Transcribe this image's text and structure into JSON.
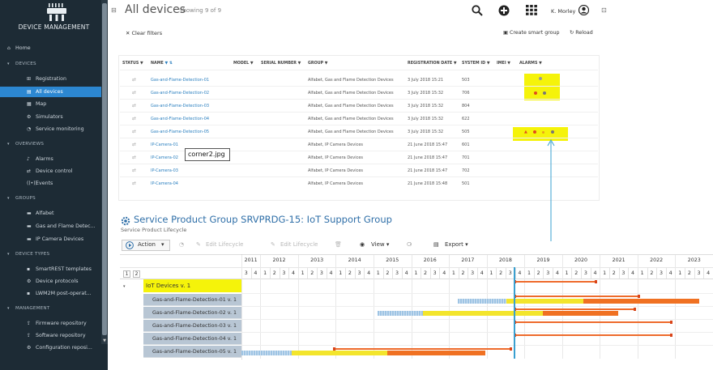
{
  "sidebar": {
    "brand": "DEVICE MANAGEMENT",
    "home": "Home",
    "sections": {
      "devices": "DEVICES",
      "overviews": "OVERVIEWS",
      "groups": "GROUPS",
      "device_types": "DEVICE TYPES",
      "management": "MANAGEMENT"
    },
    "devices_items": [
      "Registration",
      "All devices",
      "Map",
      "Simulators",
      "Service monitoring"
    ],
    "overviews_items": [
      "Alarms",
      "Device control",
      "Events"
    ],
    "groups_items": [
      "Alfabet",
      "Gas and Flame Detec...",
      "IP Camera Devices"
    ],
    "device_types_items": [
      "SmartREST templates",
      "Device protocols",
      "LWM2M post-operat..."
    ],
    "management_items": [
      "Firmware repository",
      "Software repository",
      "Configuration reposi..."
    ]
  },
  "header": {
    "title": "All devices",
    "showing": "Showing 9 of 9",
    "user": "K. Morley",
    "clear_filters": "Clear filters",
    "create_smart_group": "Create smart group",
    "reload": "Reload"
  },
  "table": {
    "columns": [
      "STATUS",
      "NAME",
      "MODEL",
      "SERIAL NUMBER",
      "GROUP",
      "REGISTRATION DATE",
      "SYSTEM ID",
      "IMEI",
      "ALARMS"
    ],
    "rows": [
      {
        "name": "Gas-and-Flame-Detection-01",
        "group": "Alfabet, Gas and Flame Detection Devices",
        "date": "3 July 2018 15:21",
        "id": "503"
      },
      {
        "name": "Gas-and-Flame-Detection-02",
        "group": "Alfabet, Gas and Flame Detection Devices",
        "date": "3 July 2018 15:32",
        "id": "706"
      },
      {
        "name": "Gas-and-Flame-Detection-03",
        "group": "Alfabet, Gas and Flame Detection Devices",
        "date": "3 July 2018 15:32",
        "id": "804"
      },
      {
        "name": "Gas-and-Flame-Detection-04",
        "group": "Alfabet, Gas and Flame Detection Devices",
        "date": "3 July 2018 15:32",
        "id": "622"
      },
      {
        "name": "Gas-and-Flame-Detection-05",
        "group": "Alfabet, Gas and Flame Detection Devices",
        "date": "3 July 2018 15:32",
        "id": "505"
      },
      {
        "name": "IP-Camera-01",
        "group": "Alfabet, IP Camera Devices",
        "date": "21 June 2018 15:47",
        "id": "601"
      },
      {
        "name": "IP-Camera-02",
        "group": "Alfabet, IP Camera Devices",
        "date": "21 June 2018 15:47",
        "id": "701"
      },
      {
        "name": "IP-Camera-03",
        "group": "Alfabet, IP Camera Devices",
        "date": "21 June 2018 15:47",
        "id": "702"
      },
      {
        "name": "IP-Camera-04",
        "group": "Alfabet, IP Camera Devices",
        "date": "21 June 2018 15:48",
        "id": "501"
      }
    ],
    "tooltip": "corner2.jpg"
  },
  "gantt": {
    "title": "Service Product Group SRVPRDG-15: IoT Support Group",
    "subtitle": "Service Product Lifecycle",
    "toolbar": {
      "action": "Action",
      "edit_lifecycle": "Edit Lifecycle",
      "edit_lifecycle_2": "Edit Lifecycle",
      "view": "View",
      "export": "Export"
    },
    "levels": [
      "1",
      "2"
    ],
    "years": [
      "2011",
      "2012",
      "2013",
      "2014",
      "2015",
      "2016",
      "2017",
      "2018",
      "2019",
      "2020",
      "2021",
      "2022",
      "2023"
    ],
    "quarters": [
      "3",
      "4",
      "1",
      "2",
      "3",
      "4",
      "1",
      "2",
      "3",
      "4",
      "1",
      "2",
      "3",
      "4",
      "1",
      "2",
      "3",
      "4",
      "1",
      "2",
      "3",
      "4",
      "1",
      "2",
      "3",
      "4",
      "1",
      "2",
      "3",
      "4",
      "1",
      "2",
      "3",
      "4",
      "1",
      "2",
      "3",
      "4",
      "1",
      "2",
      "3",
      "4",
      "1",
      "2",
      "3",
      "4",
      "1",
      "2",
      "3",
      "4"
    ],
    "group_label": "IoT Devices v. 1",
    "tasks": [
      "Gas-and-Flame-Detection-01 v. 1",
      "Gas-and-Flame-Detection-02 v. 1",
      "Gas-and-Flame-Detection-03 v. 1",
      "Gas-and-Flame-Detection-04 v. 1",
      "Gas-and-Flame-Detection-05 v. 1"
    ]
  },
  "colors": {
    "sidebar_bg": "#1d2b35",
    "active": "#2c87d1",
    "highlight": "#f5f30a",
    "group_row": "#f5f30a",
    "task_label": "#b8c6d4",
    "bar_orange": "#f07122",
    "bar_yellow": "#f3e52c",
    "bar_blue": "#a9c9e6",
    "today_line": "#3aa0d0"
  }
}
